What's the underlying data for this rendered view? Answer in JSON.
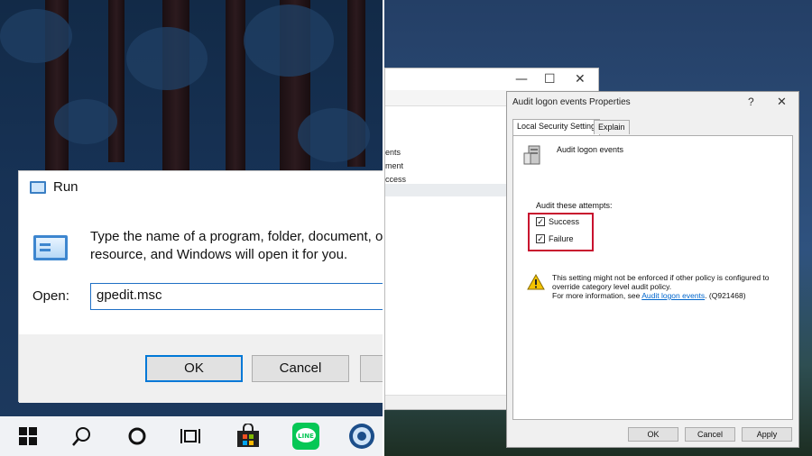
{
  "run_dialog": {
    "title": "Run",
    "description_line1": "Type the name of a program, folder, document, o",
    "description_line2": "resource, and Windows will open it for you.",
    "open_label": "Open:",
    "open_value": "gpedit.msc",
    "ok_label": "OK",
    "cancel_label": "Cancel"
  },
  "taskbar": {
    "icons": [
      "windows-start-icon",
      "search-icon",
      "cortana-icon",
      "task-view-icon",
      "store-icon",
      "line-app-icon",
      "app-icon"
    ],
    "line_label": "LINE"
  },
  "background_window": {
    "fragments": [
      "ents",
      "ment",
      "ccess"
    ]
  },
  "properties_dialog": {
    "title": "Audit logon events Properties",
    "help_glyph": "?",
    "close_glyph": "✕",
    "tabs": [
      "Local Security Setting",
      "Explain"
    ],
    "policy_name": "Audit logon events",
    "attempts_label": "Audit these attempts:",
    "success_label": "Success",
    "failure_label": "Failure",
    "success_checked": true,
    "failure_checked": true,
    "warning_line1": "This setting might not be enforced if other policy is configured to",
    "warning_line2": "override category level audit policy.",
    "warning_line3_prefix": "For more information, see ",
    "warning_link": "Audit logon events",
    "warning_line3_suffix": ". (Q921468)",
    "buttons": {
      "ok": "OK",
      "cancel": "Cancel",
      "apply": "Apply"
    }
  },
  "colors": {
    "accent": "#0078d7",
    "highlight": "#c8102e",
    "link": "#0066cc",
    "line_green": "#06c755"
  }
}
